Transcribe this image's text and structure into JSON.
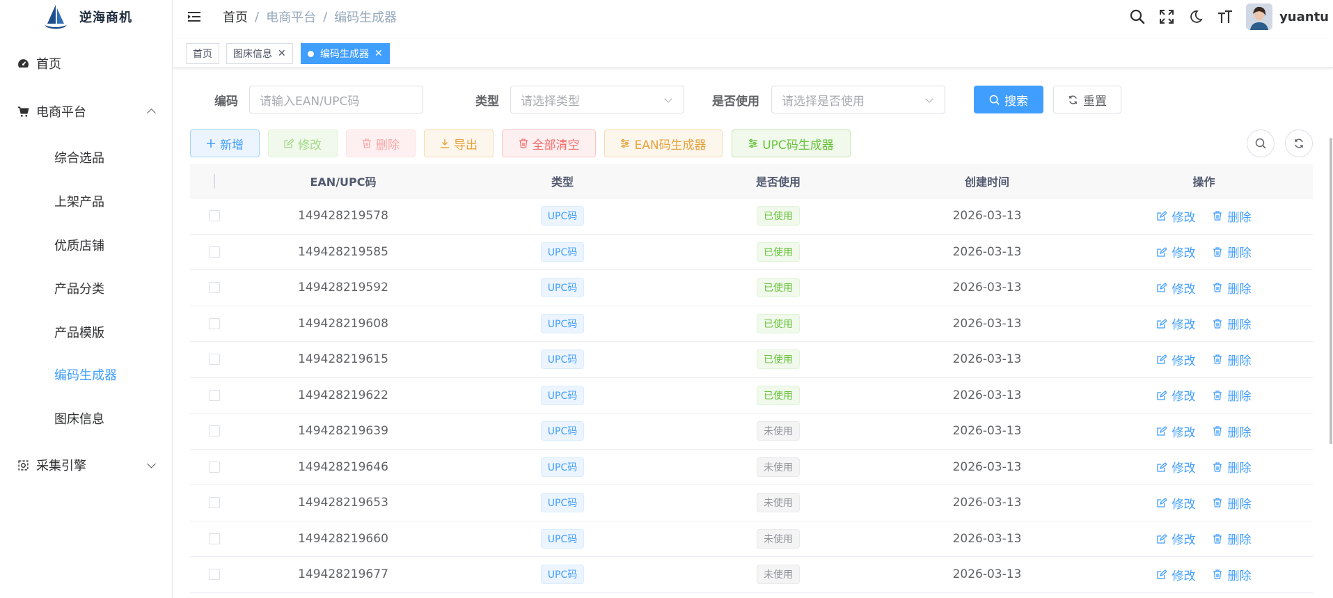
{
  "app": {
    "name": "逆海商机"
  },
  "sidebar": {
    "home": "首页",
    "ecommerce": {
      "label": "电商平台",
      "items": [
        "综合选品",
        "上架产品",
        "优质店铺",
        "产品分类",
        "产品模版",
        "编码生成器",
        "图床信息"
      ],
      "active": "编码生成器"
    },
    "collect": "采集引擎"
  },
  "header": {
    "breadcrumb": [
      "首页",
      "电商平台",
      "编码生成器"
    ],
    "separator": "/",
    "username": "yuantu"
  },
  "tags": [
    {
      "label": "首页",
      "active": false,
      "closable": false
    },
    {
      "label": "图床信息",
      "active": false,
      "closable": true
    },
    {
      "label": "编码生成器",
      "active": true,
      "closable": true
    }
  ],
  "search": {
    "code_label": "编码",
    "code_placeholder": "请输入EAN/UPC码",
    "type_label": "类型",
    "type_placeholder": "请选择类型",
    "used_label": "是否使用",
    "used_placeholder": "请选择是否使用",
    "search_button": "搜索",
    "reset_button": "重置"
  },
  "toolbar": {
    "add": "新增",
    "edit": "修改",
    "delete": "删除",
    "export": "导出",
    "clear_all": "全部清空",
    "ean_generator": "EAN码生成器",
    "upc_generator": "UPC码生成器"
  },
  "table": {
    "columns": [
      "EAN/UPC码",
      "类型",
      "是否使用",
      "创建时间",
      "操作"
    ],
    "edit_label": "修改",
    "delete_label": "删除",
    "rows": [
      {
        "code": "149428219578",
        "type": "UPC码",
        "used": "已使用",
        "created": "2026-03-13"
      },
      {
        "code": "149428219585",
        "type": "UPC码",
        "used": "已使用",
        "created": "2026-03-13"
      },
      {
        "code": "149428219592",
        "type": "UPC码",
        "used": "已使用",
        "created": "2026-03-13"
      },
      {
        "code": "149428219608",
        "type": "UPC码",
        "used": "已使用",
        "created": "2026-03-13"
      },
      {
        "code": "149428219615",
        "type": "UPC码",
        "used": "已使用",
        "created": "2026-03-13"
      },
      {
        "code": "149428219622",
        "type": "UPC码",
        "used": "已使用",
        "created": "2026-03-13"
      },
      {
        "code": "149428219639",
        "type": "UPC码",
        "used": "未使用",
        "created": "2026-03-13"
      },
      {
        "code": "149428219646",
        "type": "UPC码",
        "used": "未使用",
        "created": "2026-03-13"
      },
      {
        "code": "149428219653",
        "type": "UPC码",
        "used": "未使用",
        "created": "2026-03-13"
      },
      {
        "code": "149428219660",
        "type": "UPC码",
        "used": "未使用",
        "created": "2026-03-13"
      },
      {
        "code": "149428219677",
        "type": "UPC码",
        "used": "未使用",
        "created": "2026-03-13"
      }
    ]
  },
  "colors": {
    "primary": "#409eff",
    "success": "#67c23a",
    "warning": "#e6a23c",
    "danger": "#f56c6c",
    "info": "#909399"
  }
}
